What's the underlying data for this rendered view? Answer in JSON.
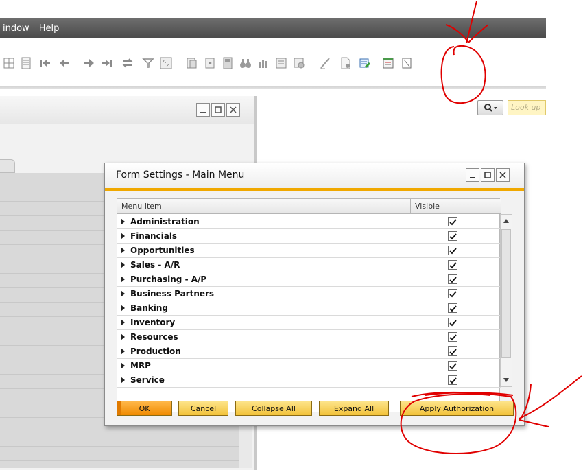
{
  "menubar": {
    "window_label": "indow",
    "help_label": "Help"
  },
  "toolbar": {
    "icons": [
      "grid-icon",
      "list-icon",
      "first-record-icon",
      "previous-record-icon",
      "next-record-icon",
      "last-record-icon",
      "refresh-icon",
      "filter-icon",
      "sort-icon",
      "copy-document-icon",
      "paste-document-icon",
      "calculator-icon",
      "binoculars-icon",
      "chart-icon",
      "pick-list-icon",
      "settings-doc-icon",
      "pen-icon",
      "form-settings-icon",
      "query-icon",
      "calendar-icon",
      "more-icon"
    ]
  },
  "search": {
    "placeholder": "Look up"
  },
  "dialog": {
    "title": "Form Settings - Main Menu",
    "columns": {
      "menu_item": "Menu Item",
      "visible": "Visible"
    },
    "rows": [
      {
        "label": "Administration",
        "visible": true
      },
      {
        "label": "Financials",
        "visible": true
      },
      {
        "label": "Opportunities",
        "visible": true
      },
      {
        "label": "Sales - A/R",
        "visible": true
      },
      {
        "label": "Purchasing - A/P",
        "visible": true
      },
      {
        "label": "Business Partners",
        "visible": true
      },
      {
        "label": "Banking",
        "visible": true
      },
      {
        "label": "Inventory",
        "visible": true
      },
      {
        "label": "Resources",
        "visible": true
      },
      {
        "label": "Production",
        "visible": true
      },
      {
        "label": "MRP",
        "visible": true
      },
      {
        "label": "Service",
        "visible": true
      }
    ],
    "buttons": {
      "ok": "OK",
      "cancel": "Cancel",
      "collapse_all": "Collapse All",
      "expand_all": "Expand All",
      "apply_authorization": "Apply Authorization"
    }
  },
  "colors": {
    "accent": "#f0a800",
    "button": "#f2c23a",
    "menubar": "#5a5a5a",
    "annotation": "#e00000"
  }
}
